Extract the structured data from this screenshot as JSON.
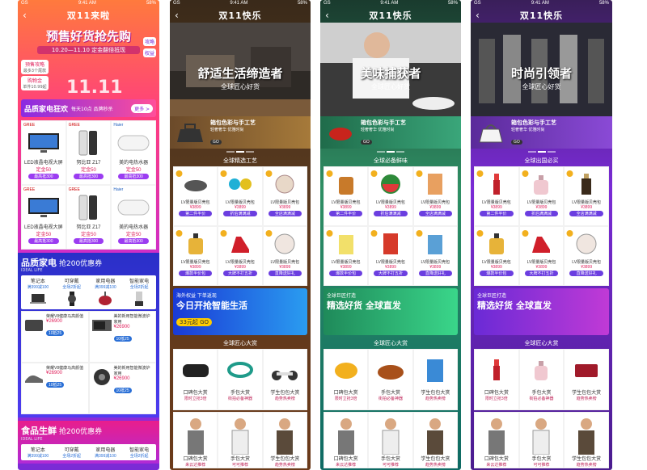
{
  "status": {
    "carrier": "GS",
    "time": "9:41 AM",
    "battery": "58%"
  },
  "p1": {
    "title": "双11来啦",
    "headline": "预售好货抢先购",
    "dates": "10.20—11.10 定金翻倍抵现",
    "badge_left_1": "预售攻略",
    "badge_left_1_sub": "最多3个尾款",
    "badge_left_2": "购物金",
    "badge_left_2_sub": "单件10.99起",
    "badge_right_1": "攻略",
    "badge_right_2": "权益",
    "big": "11.11",
    "promo": {
      "title": "品质家电狂欢",
      "sub": "每天10点 品牌秒杀",
      "btn": "更多 >"
    },
    "grid": [
      {
        "brand": "GREE",
        "name": "LED液晶电视大屏",
        "price": "定金50",
        "tag": "最高抵300"
      },
      {
        "brand": "GREE",
        "name": "努比亚 Z17",
        "price": "定金50",
        "tag": "最高抵300"
      },
      {
        "brand": "Haier",
        "name": "美的电热水器",
        "price": "定金50",
        "tag": "最高抵300"
      },
      {
        "brand": "GREE",
        "name": "LED液晶电视大屏",
        "price": "定金50",
        "tag": "最高抵300"
      },
      {
        "brand": "GREE",
        "name": "努比亚 Z17",
        "price": "定金50",
        "tag": "最高抵300"
      },
      {
        "brand": "Haier",
        "name": "美的电热水器",
        "price": "定金50",
        "tag": "最高抵300"
      }
    ],
    "section1": {
      "title": "品质家电",
      "sub": "抢200优惠券",
      "en": "IDEAL LIFE"
    },
    "cats": [
      {
        "n": "笔记本",
        "d": "满399减100"
      },
      {
        "n": "可穿戴",
        "d": "全场2折起"
      },
      {
        "n": "家用电器",
        "d": "满399减100"
      },
      {
        "n": "智能家电",
        "d": "全场2折起"
      }
    ],
    "prods": [
      {
        "t": "荣耀V8健康马高颜值",
        "p": "¥26900",
        "c": "10抵25"
      },
      {
        "t": "美的新用智能微波炉家用",
        "p": "¥26900",
        "c": "10抵25"
      },
      {
        "t": "荣耀V8健康马高颜值",
        "p": "¥26900",
        "c": "10抵25"
      },
      {
        "t": "美的新用智能微波炉家用",
        "p": "¥26900",
        "c": "10抵25"
      }
    ],
    "section2": {
      "title": "食品生鲜",
      "sub": "抢200优惠券",
      "en": "IDEAL LIFE"
    }
  },
  "p2": {
    "title": "双11快乐",
    "headline": "舒适生活缔造者",
    "sub": "全球匠心好货",
    "featured": {
      "title": "箱包色彩与手工艺",
      "sub": "轻奢奢华 优雅时尚",
      "go": "GO"
    },
    "ribbon": "全球精选工艺",
    "grid": [
      {
        "name": "LV限量版贝壳包",
        "price": "¥3899",
        "tag": "第二件半价"
      },
      {
        "name": "LV限量版贝壳包",
        "price": "¥3899",
        "tag": "折后满满减"
      },
      {
        "name": "LV限量版贝壳包",
        "price": "¥3899",
        "tag": "全店满满减"
      },
      {
        "name": "LV限量版贝壳包",
        "price": "¥3899",
        "tag": "爆款半价包"
      },
      {
        "name": "LV限量版贝壳包",
        "price": "¥3899",
        "tag": "大牌不打五折"
      },
      {
        "name": "LV限量版贝壳包",
        "price": "¥3899",
        "tag": "直降送好礼"
      }
    ],
    "banner": {
      "l1": "海外权益 下单返现",
      "l2": "今日开抢智能生活",
      "l3": "33元起 GO"
    },
    "award": "全球匠心大赏",
    "row3": [
      {
        "name": "口碑包大赏",
        "sub": "限时立抢3倍"
      },
      {
        "name": "手包大赏",
        "sub": "街拍必备神器"
      },
      {
        "name": "学生包包大赏",
        "sub": "趋势热卖榜"
      }
    ],
    "row4": [
      {
        "name": "口碑包大赏",
        "sub": "来云达推荐"
      },
      {
        "name": "手包大赏",
        "sub": "可可推荐"
      },
      {
        "name": "学生包包大赏",
        "sub": "趋势热卖榜"
      }
    ]
  },
  "p3": {
    "title": "双11快乐",
    "headline": "美味捕获者",
    "sub": "全球匠心好货",
    "featured": {
      "title": "箱包色彩与手工艺",
      "sub": "轻奢奢华 优雅时尚",
      "go": "GO"
    },
    "ribbon": "全球必备鲜味",
    "grid": [
      {
        "name": "LV限量版贝壳包",
        "price": "¥3899",
        "tag": "第二件半价"
      },
      {
        "name": "LV限量版贝壳包",
        "price": "¥3899",
        "tag": "折后满满减"
      },
      {
        "name": "LV限量版贝壳包",
        "price": "¥3899",
        "tag": "全店满满减"
      },
      {
        "name": "LV限量版贝壳包",
        "price": "¥3899",
        "tag": "爆款半价包"
      },
      {
        "name": "LV限量版贝壳包",
        "price": "¥3899",
        "tag": "大牌不打五折"
      },
      {
        "name": "LV限量版贝壳包",
        "price": "¥3899",
        "tag": "直降送好礼"
      }
    ],
    "banner": {
      "l1": "全球巨匠打造",
      "l2": "精选好货 全球直发",
      "l3": ""
    },
    "award": "全球匠心大赏",
    "row3": [
      {
        "name": "口碑包大赏",
        "sub": "限时立抢3倍"
      },
      {
        "name": "手包大赏",
        "sub": "街拍必备神器"
      },
      {
        "name": "学生包包大赏",
        "sub": "趋势热卖榜"
      }
    ],
    "row4": [
      {
        "name": "口碑包大赏",
        "sub": "来云达推荐"
      },
      {
        "name": "手包大赏",
        "sub": "可可推荐"
      },
      {
        "name": "学生包包大赏",
        "sub": "趋势热卖榜"
      }
    ]
  },
  "p4": {
    "title": "双11快乐",
    "headline": "时尚引领者",
    "sub": "全球匠心好货",
    "featured": {
      "title": "箱包色彩与手工艺",
      "sub": "轻奢奢华 优雅时尚",
      "go": "GO"
    },
    "ribbon": "全球出国必买",
    "grid": [
      {
        "name": "LV限量版贝壳包",
        "price": "¥3899",
        "tag": "第二件半价"
      },
      {
        "name": "LV限量版贝壳包",
        "price": "¥3899",
        "tag": "折后满满减"
      },
      {
        "name": "LV限量版贝壳包",
        "price": "¥3899",
        "tag": "全店满满减"
      },
      {
        "name": "LV限量版贝壳包",
        "price": "¥3899",
        "tag": "爆款半价包"
      },
      {
        "name": "LV限量版贝壳包",
        "price": "¥3899",
        "tag": "大牌不打五折"
      },
      {
        "name": "LV限量版贝壳包",
        "price": "¥3899",
        "tag": "直降送好礼"
      }
    ],
    "banner": {
      "l1": "全球巨匠打造",
      "l2": "精选好货 全球直发",
      "l3": ""
    },
    "award": "全球匠心大赏",
    "row3": [
      {
        "name": "口碑包大赏",
        "sub": "限时立抢3倍"
      },
      {
        "name": "手包大赏",
        "sub": "街拍必备神器"
      },
      {
        "name": "学生包包大赏",
        "sub": "趋势热卖榜"
      }
    ],
    "row4": [
      {
        "name": "口碑包大赏",
        "sub": "来云达推荐"
      },
      {
        "name": "手包大赏",
        "sub": "可可推荐"
      },
      {
        "name": "学生包包大赏",
        "sub": "趋势热卖榜"
      }
    ]
  }
}
